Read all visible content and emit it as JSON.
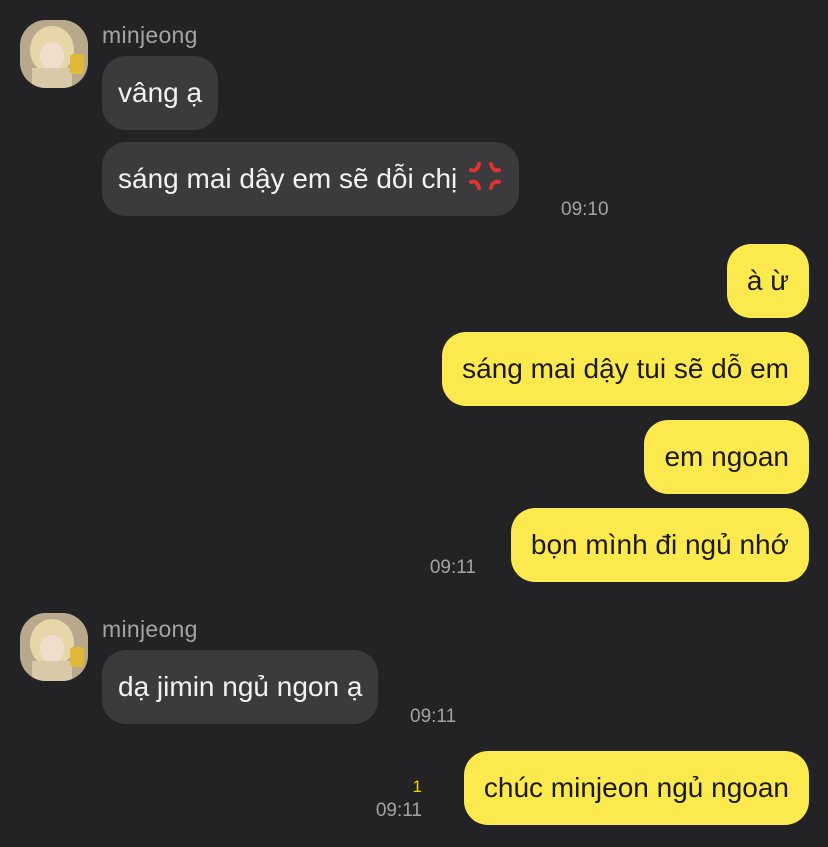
{
  "conversation": {
    "groups": [
      {
        "sender": "minjeong",
        "avatar_icon": "avatar-photo",
        "messages": [
          "vâng ạ",
          "sáng mai dậy em sẽ dỗi chị"
        ],
        "emoji": "anger-symbol-icon",
        "time": "09:10"
      },
      {
        "sender": "me",
        "messages": [
          "à ừ",
          "sáng mai dậy tui sẽ dỗ em",
          "em ngoan",
          "bọn mình đi ngủ nhớ"
        ],
        "time": "09:11"
      },
      {
        "sender": "minjeong",
        "avatar_icon": "avatar-photo",
        "messages": [
          "dạ jimin ngủ ngon ạ"
        ],
        "time": "09:11"
      },
      {
        "sender": "me",
        "messages": [
          "chúc minjeon ngủ ngoan"
        ],
        "unread_count": "1",
        "time": "09:11"
      }
    ]
  },
  "colors": {
    "background": "#232326",
    "incoming_bubble": "#3b3b3e",
    "outgoing_bubble": "#fbe94d",
    "timestamp": "#a3a3a3",
    "unread": "#f2d300"
  }
}
